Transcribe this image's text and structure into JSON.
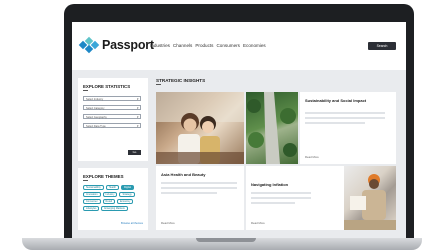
{
  "app": {
    "brand": "Passport",
    "nav": [
      "Industries",
      "Channels",
      "Products",
      "Consumers",
      "Economies"
    ],
    "search_label": "Search"
  },
  "explore_statistics": {
    "title": "EXPLORE STATISTICS",
    "selects": [
      "Select Industry",
      "Select Category",
      "Select Geography",
      "Select Data Type"
    ],
    "go_label": "Go"
  },
  "explore_themes": {
    "title": "EXPLORE THEMES",
    "chips": [
      "Sustainability",
      "Health",
      "Digital",
      "Innovation",
      "Industry",
      "Strategy",
      "Consumer",
      "Retail",
      "Economy",
      "Lifestyles",
      "Emerging Markets"
    ],
    "active_chip_index": 2,
    "browse_label": "Browse all themes"
  },
  "insights": {
    "title": "STRATEGIC INSIGHTS",
    "cards": [
      {
        "title": "Sustainability and Social Impact",
        "more": "Read More"
      },
      {
        "title": "Asia Health and Beauty",
        "more": "Read More"
      },
      {
        "title": "Navigating Inflation",
        "more": "Read More"
      }
    ]
  },
  "colors": {
    "accent": "#2a9ab0",
    "dark_button": "#2c2f36",
    "logo_blue": "#1e88c7",
    "logo_teal": "#5fc4c9"
  }
}
